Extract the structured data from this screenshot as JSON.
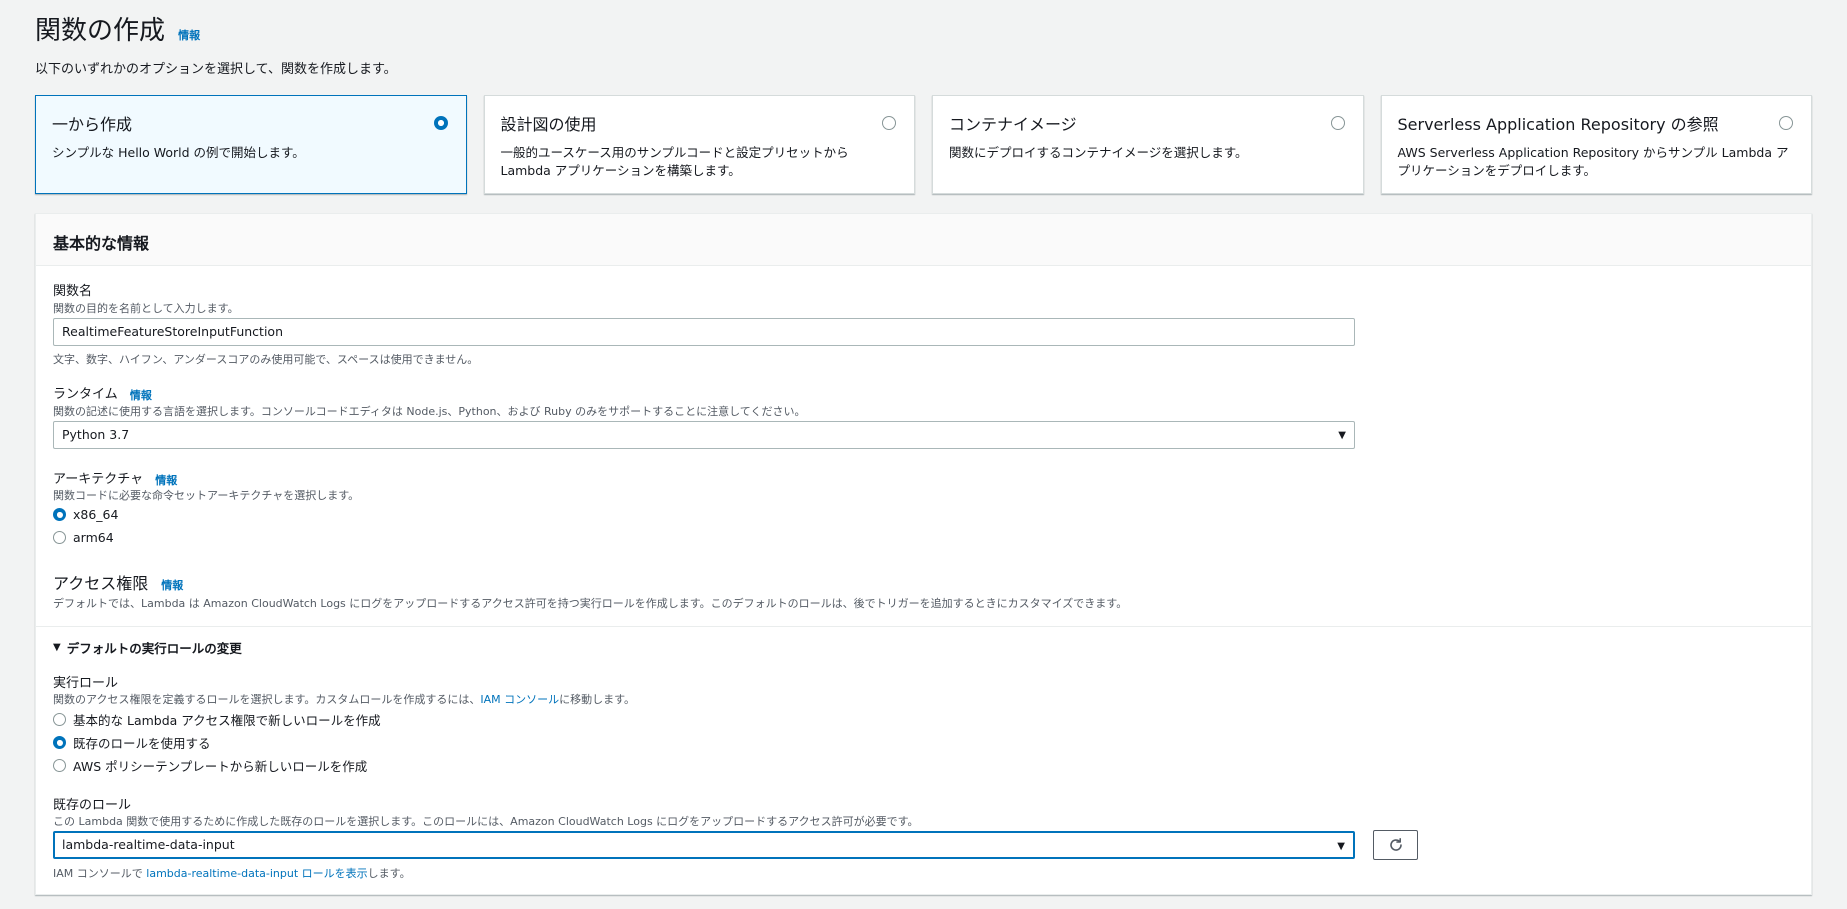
{
  "page": {
    "title": "関数の作成",
    "info": "情報",
    "subtitle": "以下のいずれかのオプションを選択して、関数を作成します。"
  },
  "options": [
    {
      "title": "一から作成",
      "description": "シンプルな Hello World の例で開始します。",
      "selected": true
    },
    {
      "title": "設計図の使用",
      "description": "一般的ユースケース用のサンプルコードと設定プリセットから Lambda アプリケーションを構築します。",
      "selected": false
    },
    {
      "title": "コンテナイメージ",
      "description": "関数にデプロイするコンテナイメージを選択します。",
      "selected": false
    },
    {
      "title": "Serverless Application Repository の参照",
      "description": "AWS Serverless Application Repository からサンプル Lambda アプリケーションをデプロイします。",
      "selected": false
    }
  ],
  "basic_info": {
    "title": "基本的な情報",
    "function_name": {
      "label": "関数名",
      "description": "関数の目的を名前として入力します。",
      "value": "RealtimeFeatureStoreInputFunction",
      "constraint": "文字、数字、ハイフン、アンダースコアのみ使用可能で、スペースは使用できません。"
    },
    "runtime": {
      "label": "ランタイム",
      "info": "情報",
      "description": "関数の記述に使用する言語を選択します。コンソールコードエディタは Node.js、Python、および Ruby のみをサポートすることに注意してください。",
      "value": "Python 3.7"
    },
    "architecture": {
      "label": "アーキテクチャ",
      "info": "情報",
      "description": "関数コードに必要な命令セットアーキテクチャを選択します。",
      "options": [
        {
          "label": "x86_64",
          "selected": true
        },
        {
          "label": "arm64",
          "selected": false
        }
      ]
    },
    "permissions": {
      "title": "アクセス権限",
      "info": "情報",
      "description": "デフォルトでは、Lambda は Amazon CloudWatch Logs にログをアップロードするアクセス許可を持つ実行ロールを作成します。このデフォルトのロールは、後でトリガーを追加するときにカスタマイズできます。"
    },
    "change_role": {
      "label": "デフォルトの実行ロールの変更"
    },
    "execution_role": {
      "label": "実行ロール",
      "description_pre": "関数のアクセス権限を定義するロールを選択します。カスタムロールを作成するには、",
      "description_link": "IAM コンソール",
      "description_post": "に移動します。",
      "options": [
        {
          "label": "基本的な Lambda アクセス権限で新しいロールを作成",
          "selected": false
        },
        {
          "label": "既存のロールを使用する",
          "selected": true
        },
        {
          "label": "AWS ポリシーテンプレートから新しいロールを作成",
          "selected": false
        }
      ]
    },
    "existing_role": {
      "label": "既存のロール",
      "description": "この Lambda 関数で使用するために作成した既存のロールを選択します。このロールには、Amazon CloudWatch Logs にログをアップロードするアクセス許可が必要です。",
      "value": "lambda-realtime-data-input",
      "footer_pre": "IAM コンソールで ",
      "footer_link": "lambda-realtime-data-input ロールを表示",
      "footer_post": "します。"
    }
  }
}
